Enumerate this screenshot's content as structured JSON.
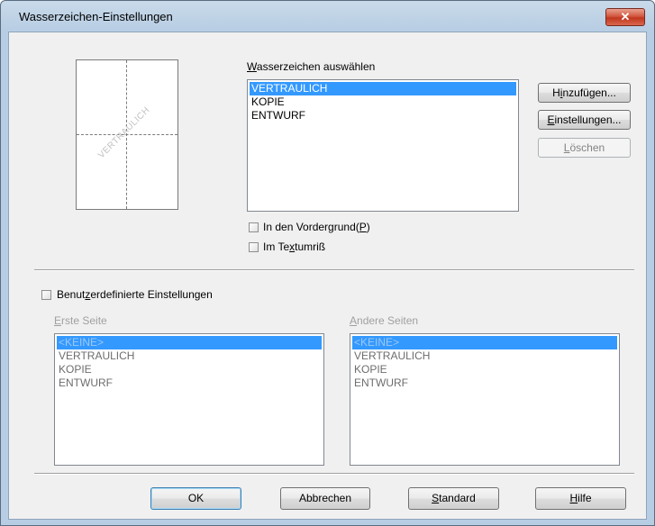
{
  "window": {
    "title": "Wasserzeichen-Einstellungen",
    "close_label": "✕"
  },
  "preview": {
    "watermark_text": "VERTRAULICH"
  },
  "watermark_select": {
    "label": "Wasserzeichen auswählen",
    "items": [
      {
        "label": "VERTRAULICH",
        "selected": true
      },
      {
        "label": "KOPIE",
        "selected": false
      },
      {
        "label": "ENTWURF",
        "selected": false
      }
    ]
  },
  "buttons_side": {
    "add": "Hinzufügen...",
    "settings": "Einstellungen...",
    "delete": "Löschen"
  },
  "checkboxes": {
    "foreground": "In den Vordergrund(P)",
    "outline": "Im Textumriß",
    "custom": "Benutzerdefinierte Einstellungen"
  },
  "first_page": {
    "label": "Erste Seite",
    "items": [
      {
        "label": "<KEINE>",
        "selected": true
      },
      {
        "label": "VERTRAULICH",
        "selected": false
      },
      {
        "label": "KOPIE",
        "selected": false
      },
      {
        "label": "ENTWURF",
        "selected": false
      }
    ]
  },
  "other_pages": {
    "label": "Andere Seiten",
    "items": [
      {
        "label": "<KEINE>",
        "selected": true
      },
      {
        "label": "VERTRAULICH",
        "selected": false
      },
      {
        "label": "KOPIE",
        "selected": false
      },
      {
        "label": "ENTWURF",
        "selected": false
      }
    ]
  },
  "footer": {
    "ok": "OK",
    "cancel": "Abbrechen",
    "default": "Standard",
    "help": "Hilfe"
  }
}
